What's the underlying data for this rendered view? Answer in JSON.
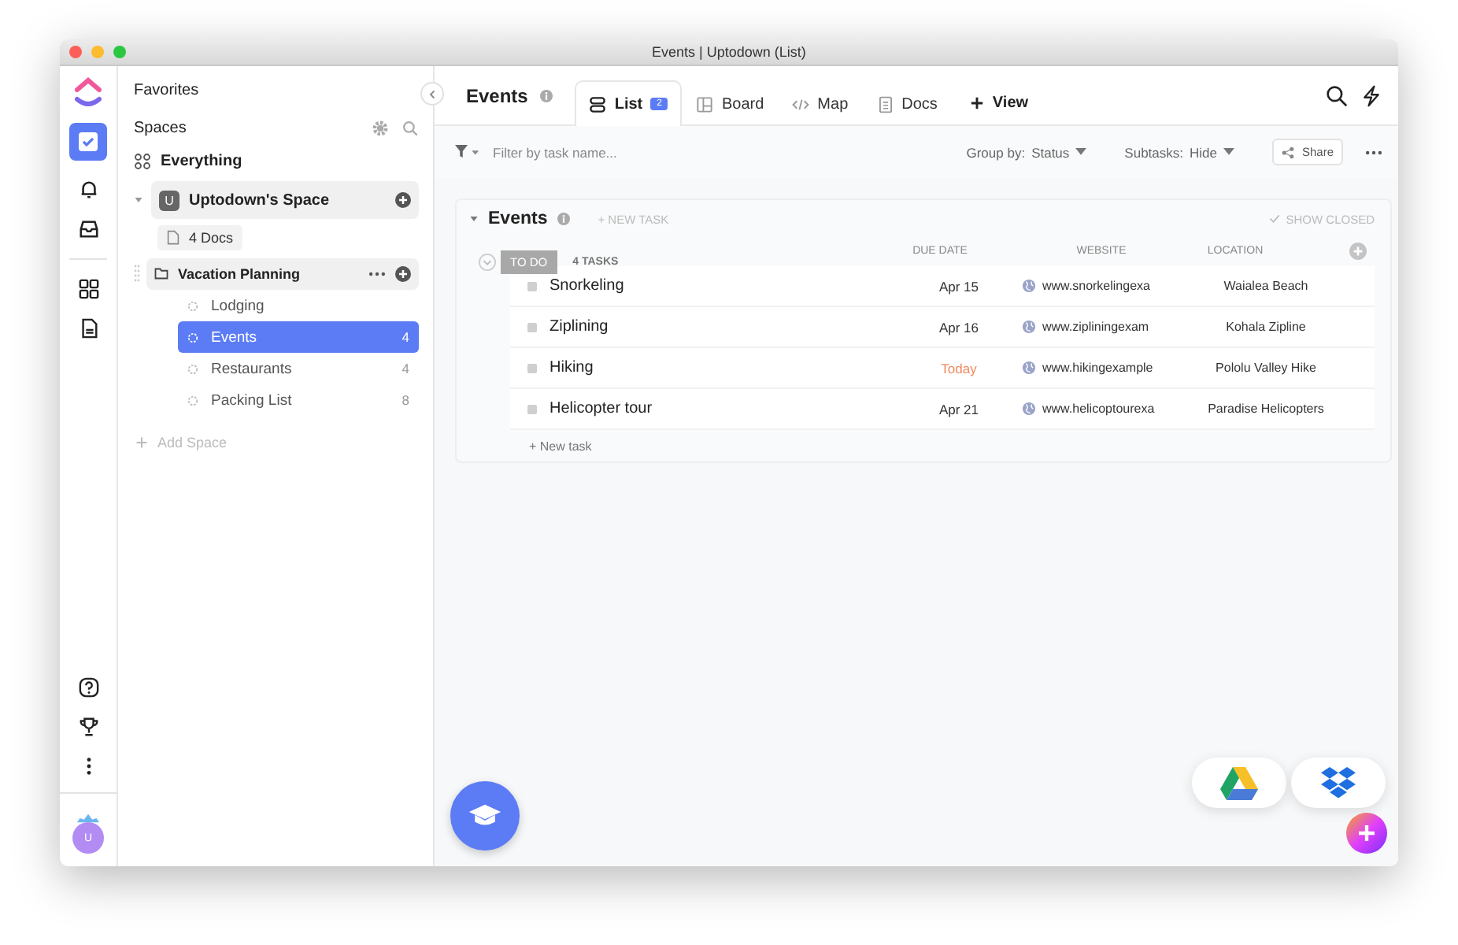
{
  "window": {
    "title": "Events | Uptodown (List)"
  },
  "rail": {
    "avatar": "U"
  },
  "sidebar": {
    "favorites": "Favorites",
    "spaces": "Spaces",
    "everything": "Everything",
    "space": {
      "badge": "U",
      "name": "Uptodown's Space",
      "expanded": true
    },
    "docs": "4 Docs",
    "folder": {
      "name": "Vacation Planning"
    },
    "lists": [
      {
        "name": "Lodging",
        "selected": false
      },
      {
        "name": "Events",
        "count": "4",
        "selected": true
      },
      {
        "name": "Restaurants",
        "count": "4",
        "selected": false
      },
      {
        "name": "Packing List",
        "count": "8",
        "selected": false
      }
    ],
    "add_space": "Add Space"
  },
  "header": {
    "title": "Events",
    "tabs": [
      {
        "kind": "list",
        "label": "List",
        "badge": "2",
        "selected": true
      },
      {
        "kind": "board",
        "label": "Board",
        "selected": false
      },
      {
        "kind": "map",
        "label": "Map",
        "selected": false
      },
      {
        "kind": "docs",
        "label": "Docs",
        "selected": false
      }
    ],
    "add_view": "View"
  },
  "toolbar": {
    "filter_placeholder": "Filter by task name...",
    "group_by_label": "Group by:",
    "group_by_value": "Status",
    "subtasks_label": "Subtasks:",
    "subtasks_value": "Hide",
    "share": "Share"
  },
  "list": {
    "title": "Events",
    "new_task": "+ NEW TASK",
    "show_closed": "SHOW CLOSED",
    "status": "TO DO",
    "task_count": "4 TASKS",
    "columns": [
      "DUE DATE",
      "WEBSITE",
      "LOCATION"
    ],
    "rows": [
      {
        "name": "Snorkeling",
        "due": "Apr 15",
        "due_today": false,
        "website": "www.snorkelingexa",
        "location": "Waialea Beach"
      },
      {
        "name": "Ziplining",
        "due": "Apr 16",
        "due_today": false,
        "website": "www.zipliningexam",
        "location": "Kohala Zipline"
      },
      {
        "name": "Hiking",
        "due": "Today",
        "due_today": true,
        "website": "www.hikingexample",
        "location": "Pololu Valley Hike"
      },
      {
        "name": "Helicopter tour",
        "due": "Apr 21",
        "due_today": false,
        "website": "www.helicoptourexa",
        "location": "Paradise Helicopters"
      }
    ],
    "add_task": "+ New task"
  }
}
